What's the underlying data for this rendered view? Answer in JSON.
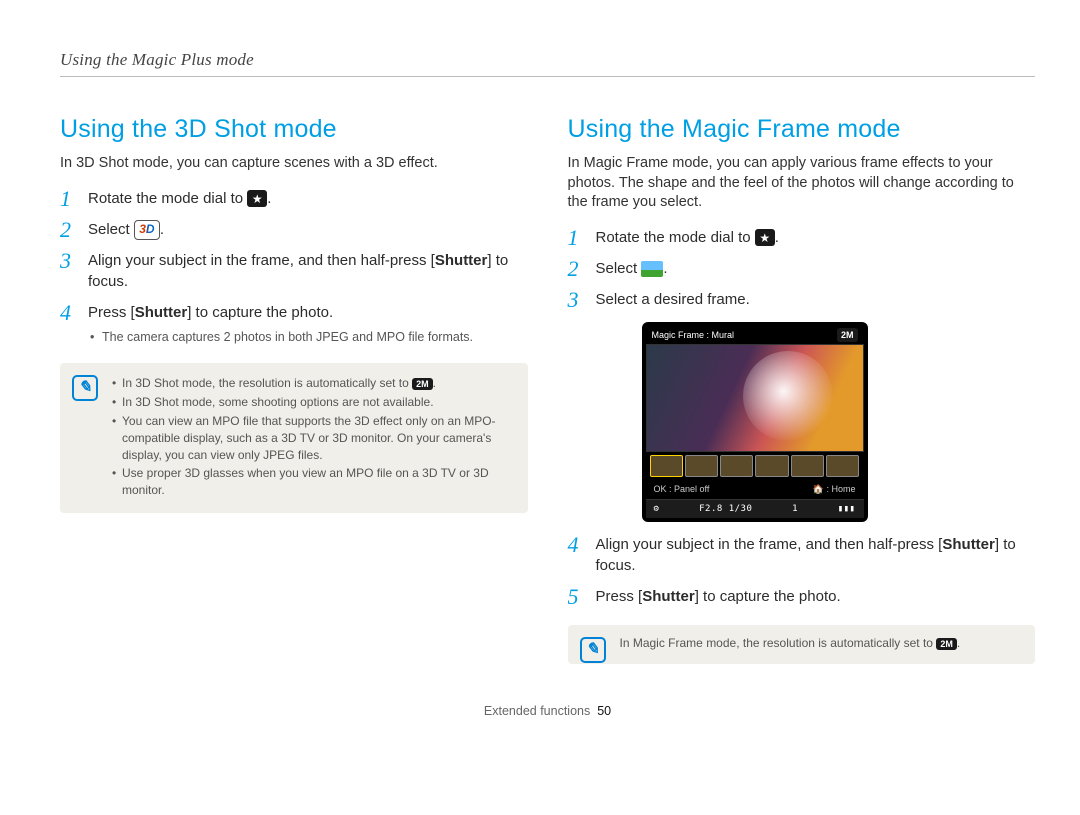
{
  "header": {
    "title": "Using the Magic Plus mode"
  },
  "footer": {
    "section": "Extended functions",
    "page": "50"
  },
  "left": {
    "title": "Using the 3D Shot mode",
    "intro": "In 3D Shot mode, you can capture scenes with a 3D effect.",
    "steps": [
      {
        "num": "1",
        "text_pre": "Rotate the mode dial to ",
        "text_post": "."
      },
      {
        "num": "2",
        "text_pre": "Select ",
        "text_post": "."
      },
      {
        "num": "3",
        "text_pre": "Align your subject in the frame, and then half-press [",
        "bold": "Shutter",
        "text_post": "] to focus."
      },
      {
        "num": "4",
        "text_pre": "Press [",
        "bold": "Shutter",
        "text_post": "] to capture the photo.",
        "sub": [
          "The camera captures 2 photos in both JPEG and MPO file formats."
        ]
      }
    ],
    "notes": [
      "In 3D Shot mode, the resolution is automatically set to ",
      "In 3D Shot mode, some shooting options are not available.",
      "You can view an MPO file that supports the 3D effect only on an MPO-compatible display, such as a 3D TV or 3D monitor. On your camera's display, you can view only JPEG files.",
      "Use proper 3D glasses when you view an MPO file on a 3D TV or 3D monitor."
    ],
    "res_icon_label": "2M"
  },
  "right": {
    "title": "Using the Magic Frame mode",
    "intro": "In Magic Frame mode, you can apply various frame effects to your photos. The shape and the feel of the photos will change according to the frame you select.",
    "steps": [
      {
        "num": "1",
        "text_pre": "Rotate the mode dial to ",
        "text_post": "."
      },
      {
        "num": "2",
        "text_pre": "Select ",
        "text_post": "."
      },
      {
        "num": "3",
        "text": "Select a desired frame."
      },
      {
        "num": "4",
        "text_pre": "Align your subject in the frame, and then half-press [",
        "bold": "Shutter",
        "text_post": "] to focus."
      },
      {
        "num": "5",
        "text_pre": "Press [",
        "bold": "Shutter",
        "text_post": "] to capture the photo."
      }
    ],
    "screen": {
      "title": "Magic Frame : Mural",
      "ok_label": "OK : Panel off",
      "home_label": ": Home",
      "fstop": "F2.8",
      "shutter": "1/30",
      "count": "1",
      "res": "2M"
    },
    "note": "In Magic Frame mode, the resolution is automatically set to ",
    "res_icon_label": "2M"
  }
}
